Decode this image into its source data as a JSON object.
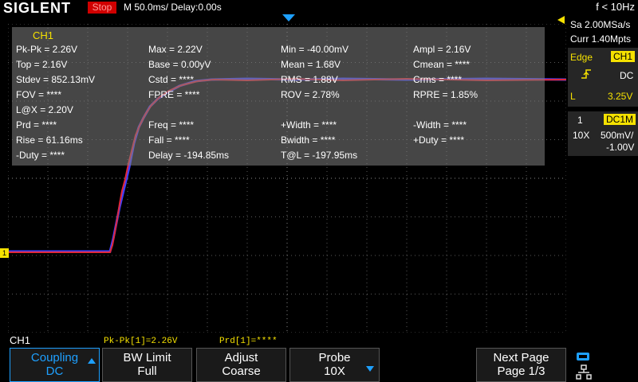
{
  "header": {
    "brand": "SIGLENT",
    "run_state": "Stop",
    "timebase": "M 50.0ms/ Delay:0.00s",
    "freq_counter": "f < 10Hz"
  },
  "panel": {
    "title": "CH1",
    "measurements": [
      "Pk-Pk = 2.26V",
      "Max = 2.22V",
      "Min = -40.00mV",
      "Ampl = 2.16V",
      "Top = 2.16V",
      "Base = 0.00yV",
      "Mean = 1.68V",
      "Cmean = ****",
      "Stdev = 852.13mV",
      "Cstd = ****",
      "RMS = 1.88V",
      "Crms = ****",
      "FOV = ****",
      "FPRE = ****",
      "ROV = 2.78%",
      "RPRE = 1.85%",
      "L@X = 2.20V",
      "Prd = ****",
      "Freq = ****",
      "+Width = ****",
      "-Width = ****",
      "Rise = 61.16ms",
      "Fall = ****",
      "Bwidth = ****",
      "+Duty = ****",
      "-Duty = ****",
      "Delay = -194.85ms",
      "T@L = -197.95ms"
    ]
  },
  "right_panel": {
    "sample_rate": "Sa 2.00MSa/s",
    "memory": "Curr 1.40Mpts",
    "trigger_type": "Edge",
    "trigger_source": "CH1",
    "trigger_coupling": "DC",
    "trigger_level_label": "L",
    "trigger_level": "3.25V",
    "channel_num": "1",
    "channel_coupling": "DC1M",
    "probe": "10X",
    "vdiv": "500mV/",
    "offset": "-1.00V"
  },
  "status_bar": {
    "channel": "CH1",
    "pkpk": "Pk-Pk[1]=2.26V",
    "prd": "Prd[1]=****"
  },
  "softkeys": [
    {
      "l1": "Coupling",
      "l2": "DC"
    },
    {
      "l1": "BW Limit",
      "l2": "Full"
    },
    {
      "l1": "Adjust",
      "l2": "Coarse"
    },
    {
      "l1": "Probe",
      "l2": "10X"
    },
    {
      "l1": "Next Page",
      "l2": "Page 1/3"
    }
  ],
  "markers": {
    "channel_marker": "1"
  },
  "colors": {
    "channel": "#f5e100",
    "accent": "#1ea0ff",
    "stop": "#d00000",
    "trace_red": "#e0283a",
    "trace_blue": "#4040ff"
  }
}
